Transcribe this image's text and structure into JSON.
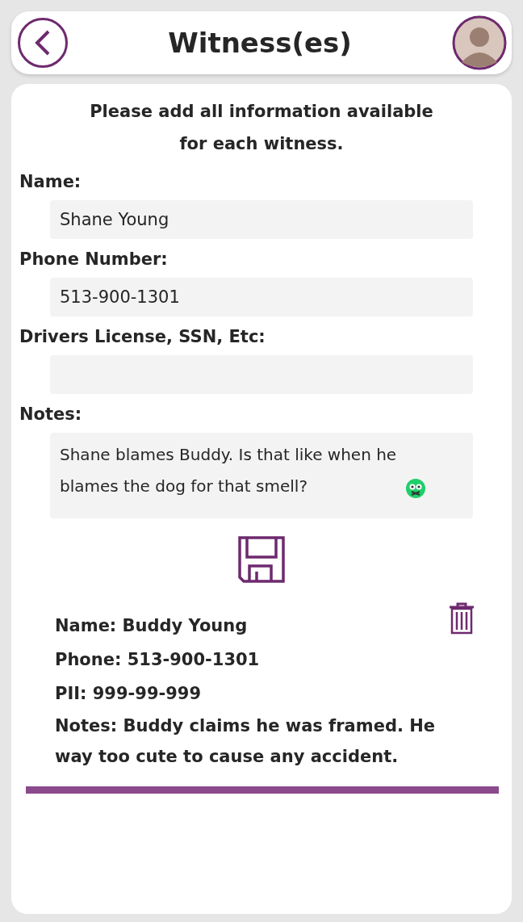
{
  "header": {
    "title": "Witness(es)"
  },
  "intro": "Please add all information available for each witness.",
  "fields": [
    {
      "label": "Name:",
      "value": "Shane Young",
      "kind": "single"
    },
    {
      "label": "Phone Number:",
      "value": "513-900-1301",
      "kind": "single"
    },
    {
      "label": "Drivers License, SSN, Etc:",
      "kind": "single"
    },
    {
      "label": "Notes:",
      "value": "Shane blames Buddy. Is that like when he blames the dog for that smell?",
      "kind": "multi"
    }
  ],
  "witnesses": [
    {
      "lines": [
        "Name: Buddy Young",
        "Phone: 513-900-1301",
        "PII: 999-99-999",
        "Notes: Buddy claims he was framed. He way too cute to cause any accident."
      ]
    }
  ]
}
